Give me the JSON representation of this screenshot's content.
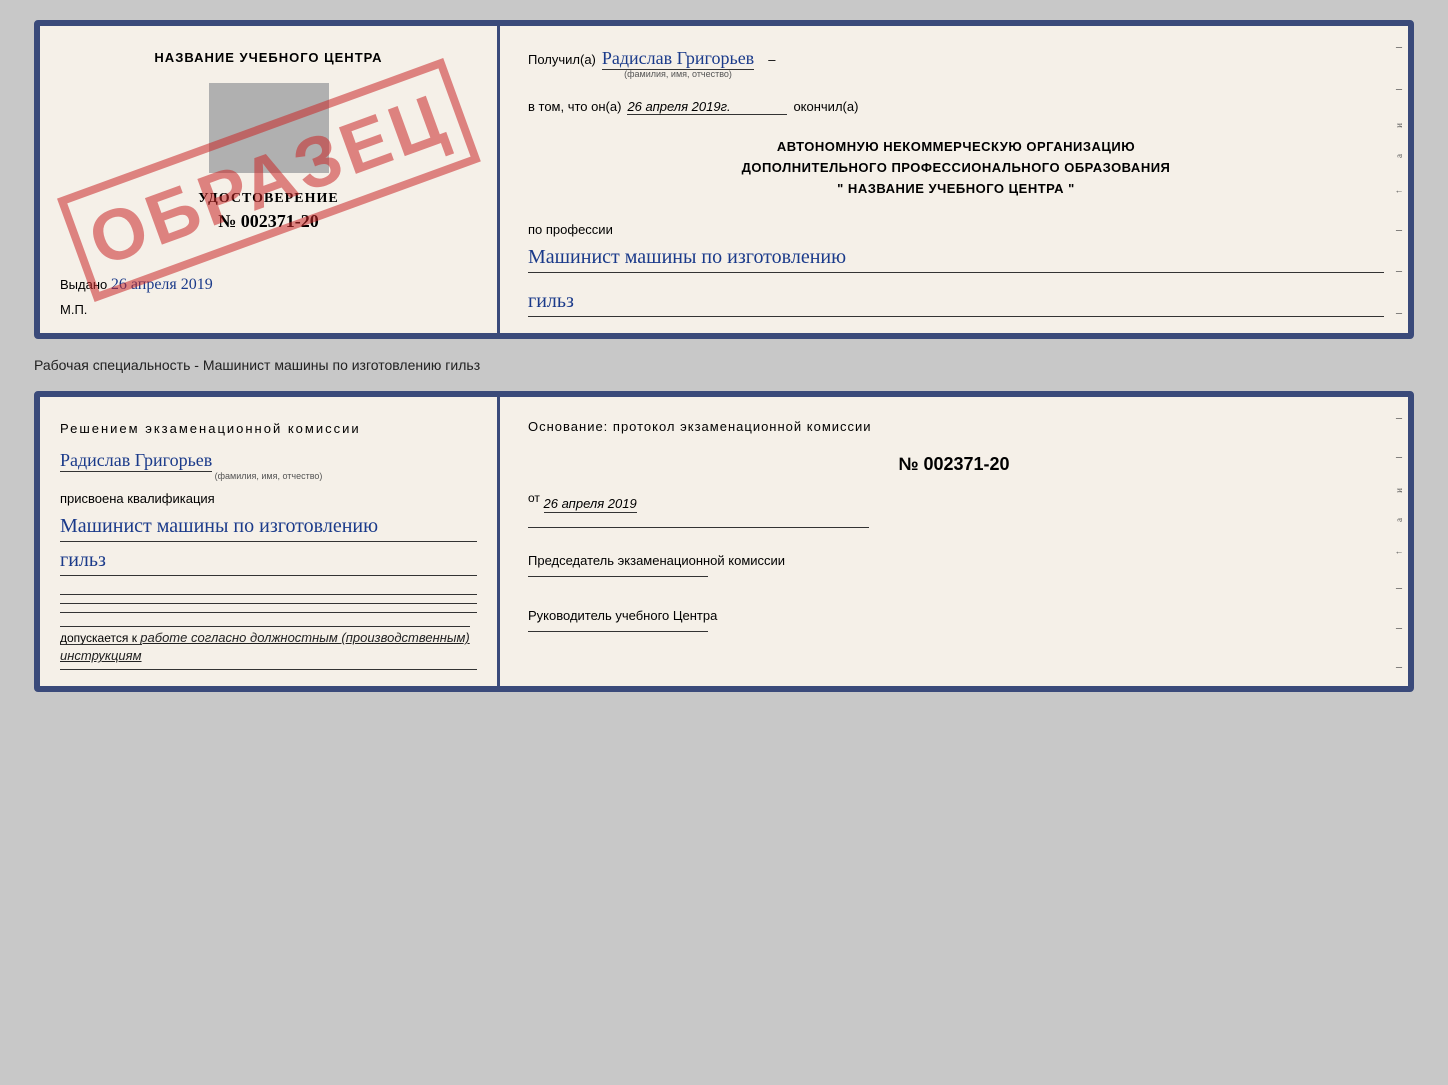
{
  "doc1": {
    "left": {
      "center_title": "НАЗВАНИЕ УЧЕБНОГО ЦЕНТРА",
      "stamp_text": "ОБРАЗЕЦ",
      "cert_label": "УДОСТОВЕРЕНИЕ",
      "cert_number": "№ 002371-20",
      "issued_label": "Выдано",
      "issued_date": "26 апреля 2019",
      "mp_label": "М.П."
    },
    "right": {
      "received_label": "Получил(а)",
      "received_name": "Радислав Григорьев",
      "name_sub": "(фамилия, имя, отчество)",
      "in_that_label": "в том, что он(а)",
      "date_value": "26 апреля 2019г.",
      "finished_label": "окончил(а)",
      "org_line1": "АВТОНОМНУЮ НЕКОММЕРЧЕСКУЮ ОРГАНИЗАЦИЮ",
      "org_line2": "ДОПОЛНИТЕЛЬНОГО ПРОФЕССИОНАЛЬНОГО ОБРАЗОВАНИЯ",
      "org_line3": "\"   НАЗВАНИЕ УЧЕБНОГО ЦЕНТРА   \"",
      "profession_label": "по профессии",
      "profession_value": "Машинист машины по изготовлению",
      "profession_value2": "гильз"
    }
  },
  "caption": {
    "text": "Рабочая специальность - Машинист машины по изготовлению гильз"
  },
  "doc2": {
    "left": {
      "decision_title": "Решением  экзаменационной  комиссии",
      "person_name": "Радислав Григорьев",
      "name_sub": "(фамилия, имя, отчество)",
      "assigned_label": "присвоена квалификация",
      "profession_value": "Машинист машины по изготовлению",
      "profession_value2": "гильз",
      "allow_prefix": "допускается к",
      "allow_text": "работе согласно должностным (производственным) инструкциям"
    },
    "right": {
      "basis_label": "Основание:  протокол  экзаменационной  комиссии",
      "protocol_number": "№  002371-20",
      "from_label": "от",
      "from_date": "26 апреля 2019",
      "chairman_label": "Председатель экзаменационной комиссии",
      "head_label": "Руководитель учебного Центра"
    }
  }
}
